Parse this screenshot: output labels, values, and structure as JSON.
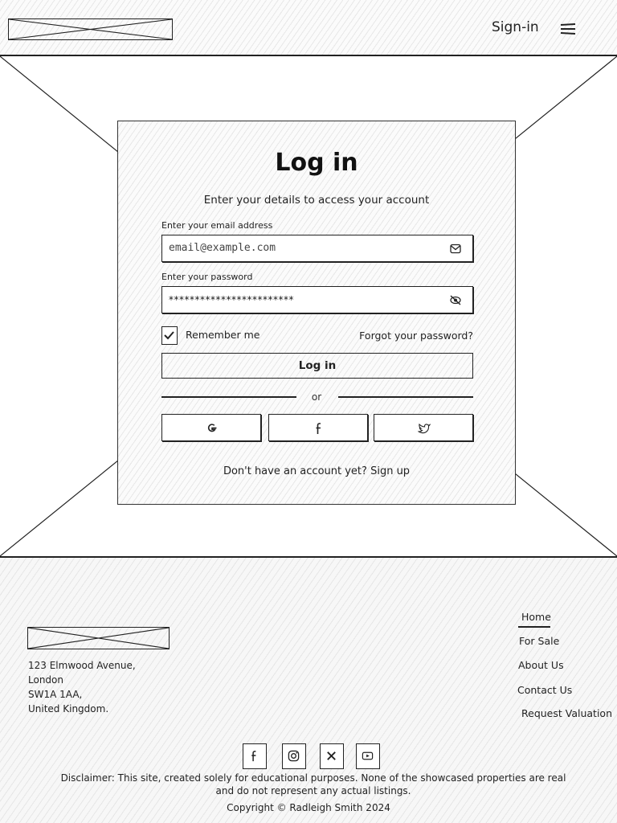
{
  "header": {
    "logo_text": "",
    "signin_label": "Sign-in",
    "menu_icon": "hamburger-menu-icon"
  },
  "login": {
    "title": "Log in",
    "subtitle": "Enter your details to access your account",
    "email_label": "Enter your email address",
    "email_placeholder": "email@example.com",
    "email_icon": "envelope-icon",
    "password_label": "Enter your password",
    "password_value": "************************",
    "password_icon": "eye-slash-icon",
    "remember_label": "Remember me",
    "remember_checked": true,
    "forgot_label": "Forgot your password?",
    "submit_label": "Log in",
    "or_label": "or",
    "social": [
      {
        "name": "Google",
        "icon": "google-icon"
      },
      {
        "name": "Facebook",
        "icon": "facebook-icon"
      },
      {
        "name": "Twitter",
        "icon": "twitter-icon"
      }
    ],
    "signup_prompt": "Don't have an account yet?",
    "signup_link": "Sign up"
  },
  "footer": {
    "address": [
      "123 Elmwood Avenue,",
      "London",
      "SW1A 1AA,",
      "United Kingdom."
    ],
    "nav": [
      "Home",
      "For Sale",
      "About Us",
      "Contact Us",
      "Request Valuation"
    ],
    "active_nav": "Home",
    "social_icons": [
      "facebook-icon",
      "instagram-icon",
      "x-icon",
      "youtube-icon"
    ],
    "disclaimer": "Disclaimer: This site, created solely for educational purposes. None of the showcased properties are real and do not represent any actual listings.",
    "copyright": "Copyright © Radleigh Smith 2024"
  }
}
